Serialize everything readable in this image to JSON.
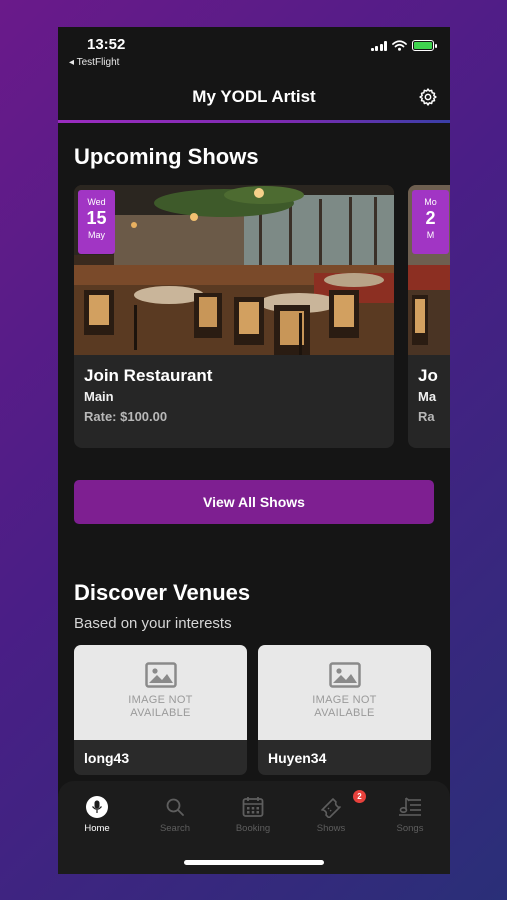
{
  "status_bar": {
    "time": "13:52",
    "back_app": "◂ TestFlight"
  },
  "header": {
    "title": "My YODL Artist",
    "settings_icon": "gear-icon"
  },
  "upcoming": {
    "title": "Upcoming Shows",
    "shows": [
      {
        "dow": "Wed",
        "day": "15",
        "month": "May",
        "venue": "Join Restaurant",
        "stage": "Main",
        "rate": "Rate: $100.00"
      },
      {
        "dow": "Mo",
        "day": "2",
        "month": "M",
        "venue": "Jo",
        "stage": "Ma",
        "rate": "Ra"
      }
    ],
    "view_all_label": "View All Shows"
  },
  "discover": {
    "title": "Discover Venues",
    "subtitle": "Based on your interests",
    "image_placeholder_line1": "IMAGE NOT",
    "image_placeholder_line2": "AVAILABLE",
    "venues": [
      {
        "name": "long43"
      },
      {
        "name": "Huyen34"
      }
    ]
  },
  "tabbar": {
    "tabs": [
      {
        "label": "Home",
        "icon": "microphone-icon",
        "active": true
      },
      {
        "label": "Search",
        "icon": "search-icon",
        "active": false
      },
      {
        "label": "Booking",
        "icon": "calendar-icon",
        "active": false
      },
      {
        "label": "Shows",
        "icon": "ticket-icon",
        "active": false,
        "badge": "2"
      },
      {
        "label": "Songs",
        "icon": "music-list-icon",
        "active": false
      }
    ]
  },
  "colors": {
    "accent": "#7e1f91",
    "badge_bg": "#a135c4",
    "notification": "#e8413c",
    "background": "#151515"
  }
}
